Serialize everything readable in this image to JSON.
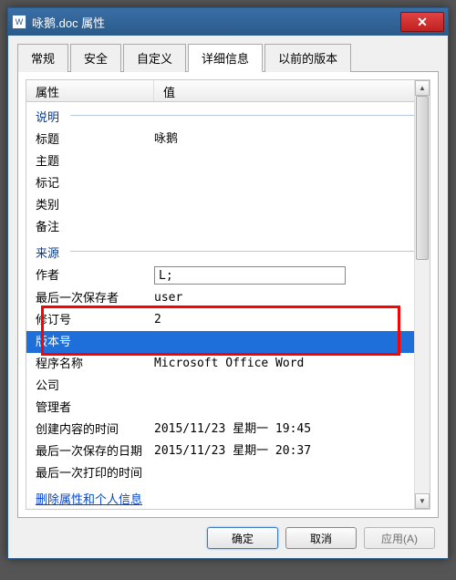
{
  "titlebar": {
    "icon_letter": "W",
    "text": "咏鹅.doc 属性"
  },
  "tabs": [
    "常规",
    "安全",
    "自定义",
    "详细信息",
    "以前的版本"
  ],
  "active_tab_index": 3,
  "columns": {
    "prop": "属性",
    "val": "值"
  },
  "sections": {
    "desc": {
      "label": "说明",
      "rows": [
        {
          "p": "标题",
          "v": "咏鹅"
        },
        {
          "p": "主题",
          "v": ""
        },
        {
          "p": "标记",
          "v": ""
        },
        {
          "p": "类别",
          "v": ""
        },
        {
          "p": "备注",
          "v": ""
        }
      ]
    },
    "origin": {
      "label": "来源",
      "rows": [
        {
          "p": "作者",
          "v": "L;",
          "editing": true
        },
        {
          "p": "最后一次保存者",
          "v": "user"
        },
        {
          "p": "修订号",
          "v": "2"
        },
        {
          "p": "版本号",
          "v": "",
          "selected": true
        },
        {
          "p": "程序名称",
          "v": "Microsoft Office Word"
        },
        {
          "p": "公司",
          "v": ""
        },
        {
          "p": "管理者",
          "v": ""
        },
        {
          "p": "创建内容的时间",
          "v": "2015/11/23 星期一 19:45"
        },
        {
          "p": "最后一次保存的日期",
          "v": "2015/11/23 星期一 20:37"
        },
        {
          "p": "最后一次打印的时间",
          "v": ""
        }
      ]
    }
  },
  "link": "删除属性和个人信息",
  "buttons": {
    "ok": "确定",
    "cancel": "取消",
    "apply": "应用(A)"
  }
}
